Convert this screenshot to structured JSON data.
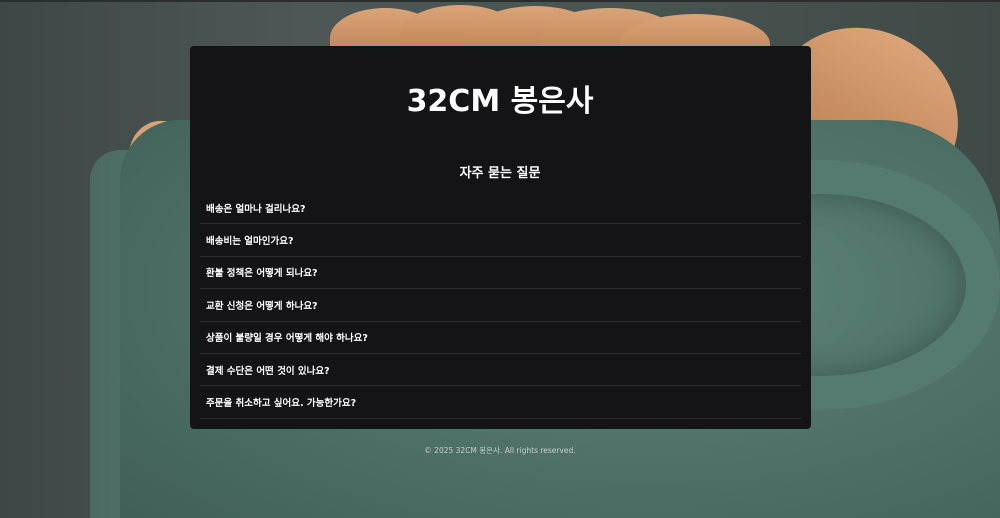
{
  "brand": {
    "title": "32CM 봉은사"
  },
  "faq": {
    "title": "자주 묻는 질문",
    "items": [
      {
        "question": "배송은 얼마나 걸리나요?"
      },
      {
        "question": "배송비는 얼마인가요?"
      },
      {
        "question": "환불 정책은 어떻게 되나요?"
      },
      {
        "question": "교환 신청은 어떻게 하나요?"
      },
      {
        "question": "상품이 불량일 경우 어떻게 해야 하나요?"
      },
      {
        "question": "결제 수단은 어떤 것이 있나요?"
      },
      {
        "question": "주문을 취소하고 싶어요. 가능한가요?"
      }
    ]
  },
  "footer": {
    "copyright": "© 2025 32CM 봉은사. All rights reserved."
  },
  "colors": {
    "card_background": "#141316",
    "text": "#ffffff",
    "divider": "#2b2a2e"
  }
}
